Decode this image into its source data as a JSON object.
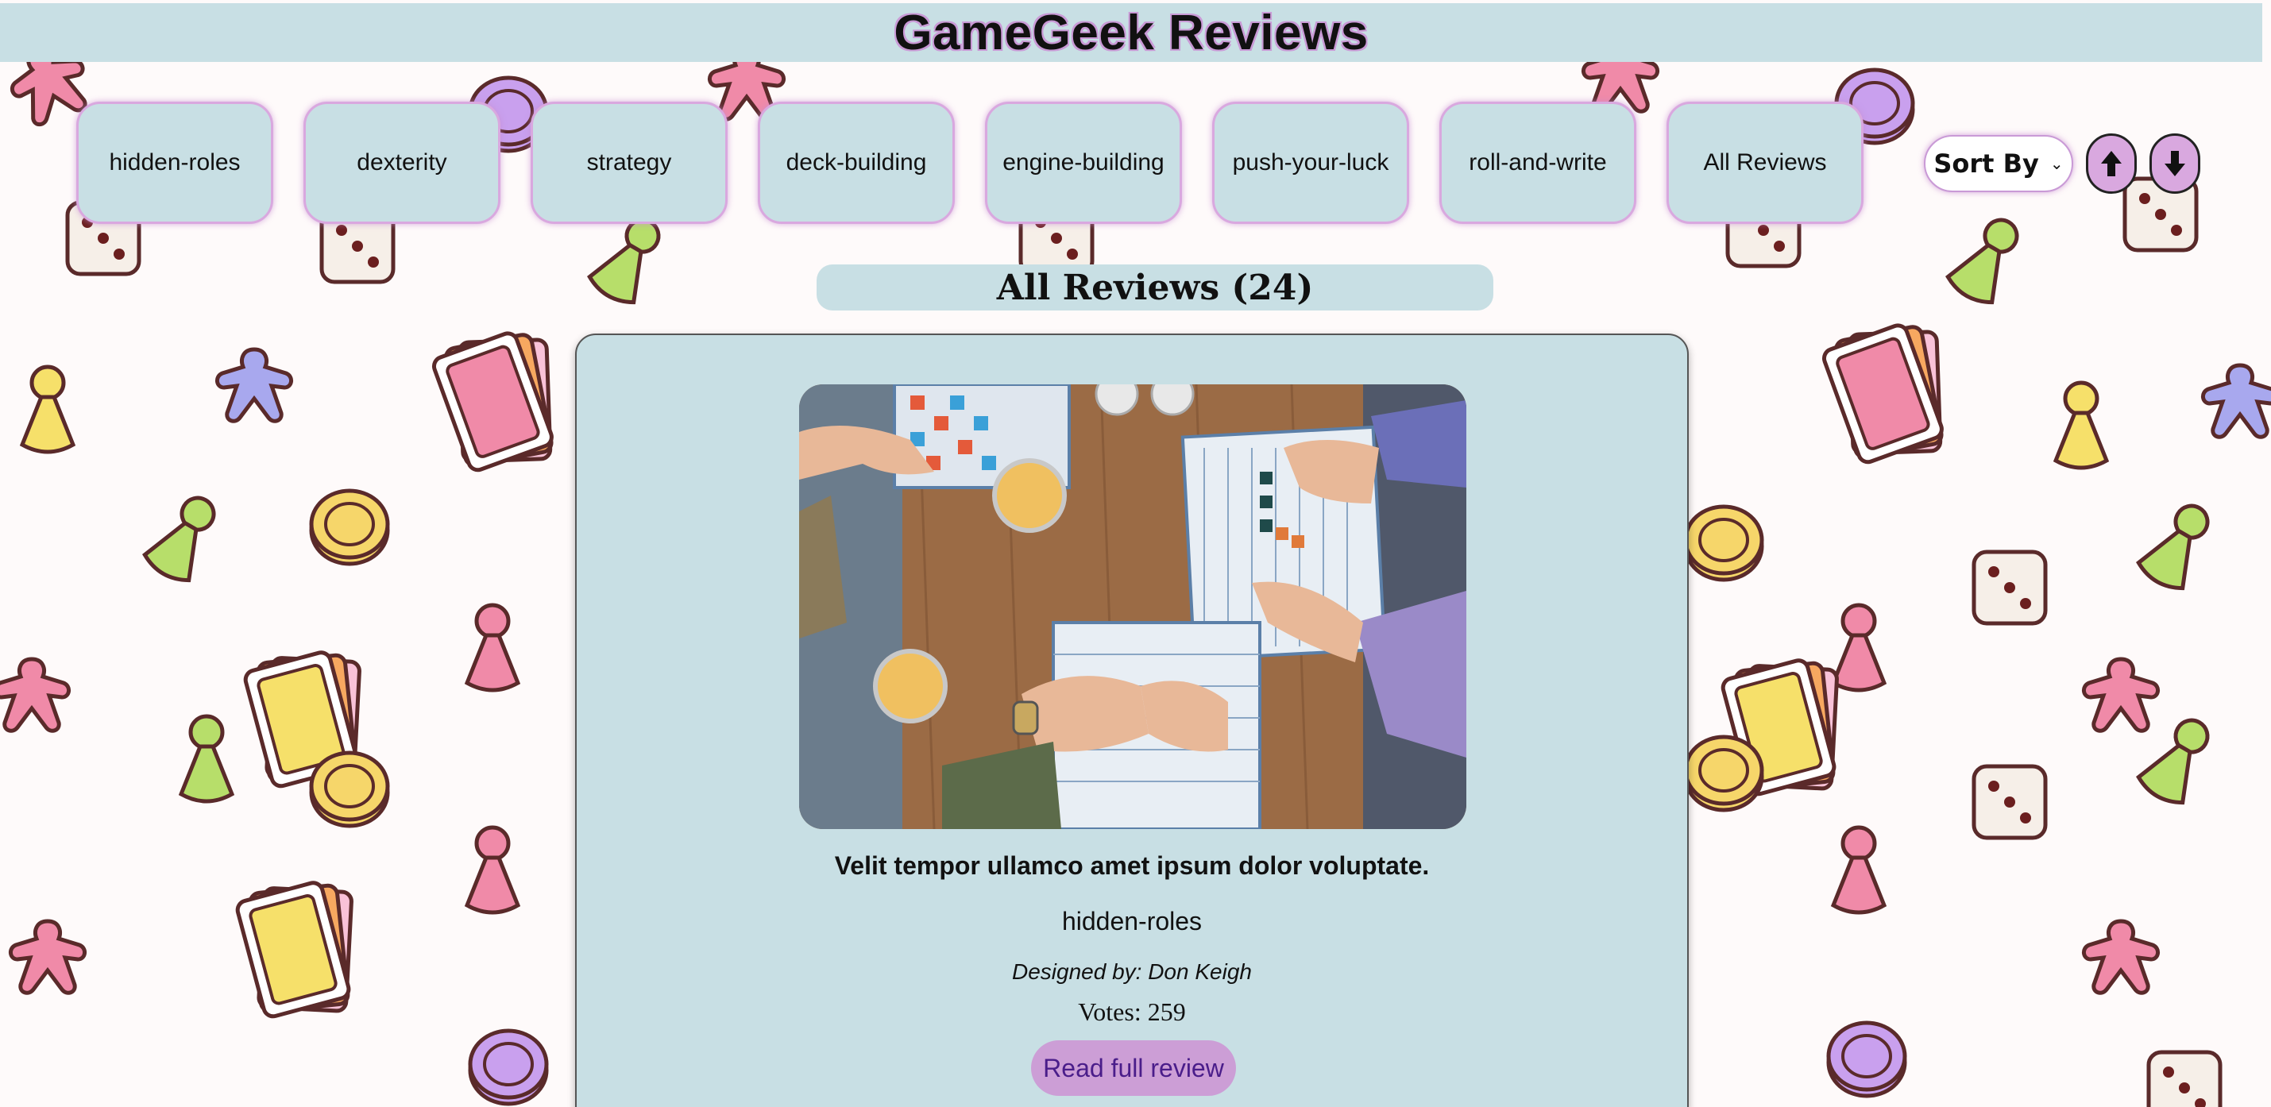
{
  "header": {
    "title": "GameGeek Reviews"
  },
  "nav": {
    "categories": [
      "hidden-roles",
      "dexterity",
      "strategy",
      "deck-building",
      "engine-building",
      "push-your-luck",
      "roll-and-write",
      "All Reviews"
    ]
  },
  "sort": {
    "label": "Sort By",
    "ascending_icon": "arrow-up-icon",
    "descending_icon": "arrow-down-icon"
  },
  "section": {
    "title": "All Reviews (24)"
  },
  "review": {
    "image_icon": "board-game-photo",
    "title": "Velit tempor ullamco amet ipsum dolor voluptate.",
    "category": "hidden-roles",
    "designer": "Designed by: Don Keigh",
    "votes": "Votes: 259",
    "read_label": "Read full review"
  },
  "colors": {
    "panel": "#c8dfe4",
    "accent": "#d9a8df",
    "button": "#cc9ed6",
    "link_text": "#4a1d8a"
  }
}
